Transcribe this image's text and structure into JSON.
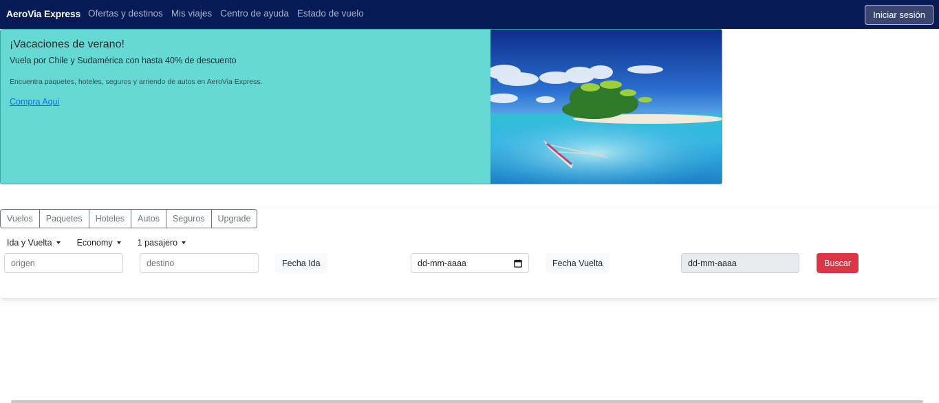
{
  "navbar": {
    "brand": "AeroVia Express",
    "links": [
      "Ofertas y destinos",
      "Mis viajes",
      "Centro de ayuda",
      "Estado de vuelo"
    ],
    "login_label": "Iniciar sesión"
  },
  "promo": {
    "title": "¡Vacaciones de verano!",
    "subtitle": "Vuela por Chile y Sudamérica con hasta 40% de descuento",
    "text": "Encuentra paquetes, hoteles, seguros y arriendo de autos en AeroVia Express.",
    "link_label": "Compra Aqui",
    "image": "tropical-island-photo"
  },
  "search": {
    "tabs": [
      "Vuelos",
      "Paquetes",
      "Hoteles",
      "Autos",
      "Seguros",
      "Upgrade"
    ],
    "trip_type": "Ida y Vuelta",
    "cabin_class": "Economy",
    "passengers": "1 pasajero",
    "origin_placeholder": "origen",
    "destination_placeholder": "destino",
    "departure_label": "Fecha Ida",
    "departure_value": "dd-mm-aaaa",
    "return_label": "Fecha Vuelta",
    "return_value": "dd-mm-aaaa",
    "search_label": "Buscar"
  },
  "colors": {
    "navbar_bg": "#061a55",
    "promo_bg": "#66d9d4",
    "primary_link": "#0d6efd",
    "danger": "#dc3545"
  }
}
